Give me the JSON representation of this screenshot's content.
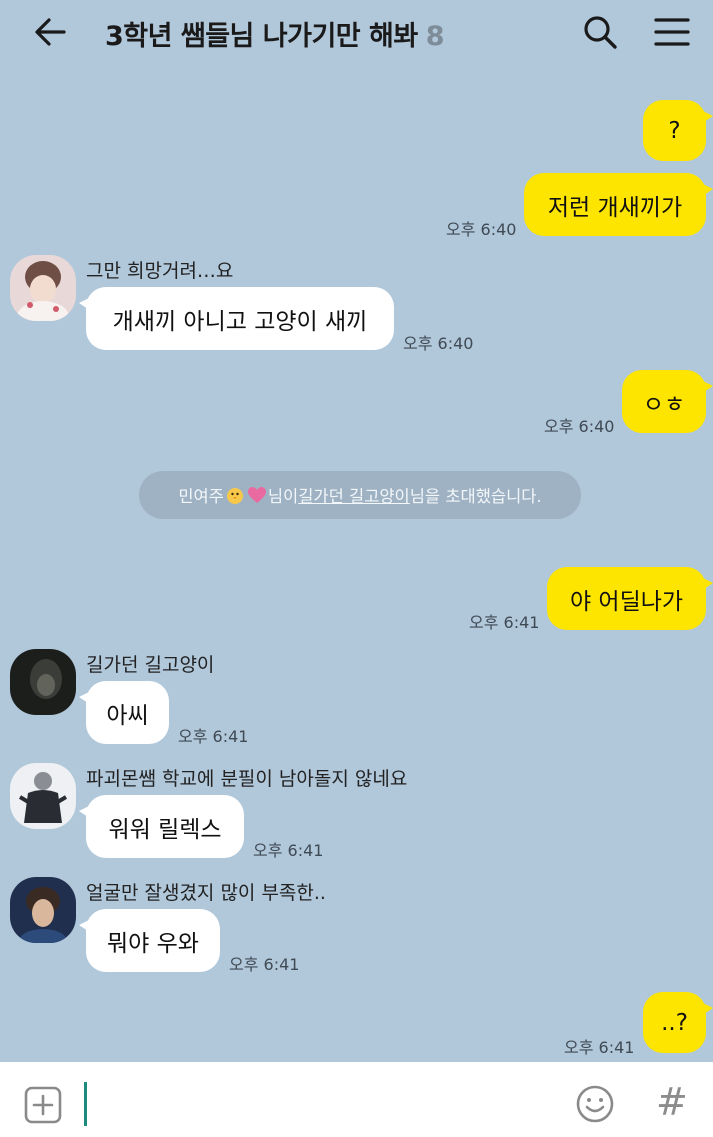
{
  "header": {
    "title": "3학년 쌤들님 나가기만 해봐",
    "member_count": "8",
    "back_icon": "arrow-left-icon",
    "search_icon": "search-icon",
    "menu_icon": "hamburger-menu-icon"
  },
  "colors": {
    "background": "#b1c7da",
    "my_bubble": "#fee500",
    "their_bubble": "#ffffff",
    "notice_bg": "#9fb2c3",
    "cursor": "#1c8a7c"
  },
  "messages": [
    {
      "side": "mine",
      "text": "?"
    },
    {
      "side": "mine",
      "text": "저런 개새끼가",
      "time": "오후 6:40"
    },
    {
      "side": "theirs",
      "sender": "그만 희망거려…요",
      "text": "개새끼 아니고 고양이 새끼",
      "time": "오후 6:40"
    },
    {
      "side": "mine",
      "text": "ㅇㅎ",
      "time": "오후 6:40"
    },
    {
      "side": "mine",
      "text": "야 어딜나가",
      "time": "오후 6:41"
    },
    {
      "side": "theirs",
      "sender": "길가던 길고양이",
      "text": "아씨",
      "time": "오후 6:41"
    },
    {
      "side": "theirs",
      "sender": "파괴몬쌤 학교에 분필이 남아돌지 않네요",
      "text": "워워 릴렉스",
      "time": "오후 6:41"
    },
    {
      "side": "theirs",
      "sender": "얼굴만 잘생겼지 많이 부족한..",
      "text": "뭐야 우와",
      "time": "오후 6:41"
    },
    {
      "side": "mine",
      "text": "..?",
      "time": "오후 6:41"
    }
  ],
  "notice": {
    "inviter": "민여주",
    "part1": "님이 ",
    "invitee": "길가던 길고양이",
    "part2": "님을 초대했습니다."
  },
  "input_bar": {
    "add_icon": "plus-square-icon",
    "emoji_icon": "smiley-icon",
    "hash_label": "#"
  }
}
